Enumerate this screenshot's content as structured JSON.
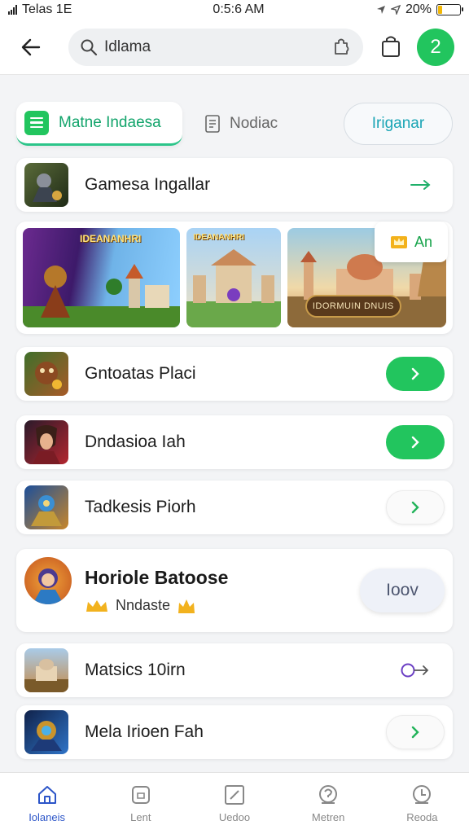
{
  "status_bar": {
    "carrier": "Telas 1E",
    "time": "0:5:6 AM",
    "battery_percent": "20%",
    "battery_level": 0.2
  },
  "header": {
    "search_value": "Idlama",
    "avatar_text": "2"
  },
  "tabs": {
    "active_label": "Matne Indaesa",
    "second_label": "Nodiac",
    "pill_label": "Iriganar"
  },
  "list": {
    "first_item": "Gamesa Ingallar",
    "banner_top_text": "IDEANANHRI",
    "banner_caption": "IDORMUIN DNUIS",
    "banner_badge_label": "An",
    "items": [
      {
        "title": "Gntoatas Placi",
        "action": "green"
      },
      {
        "title": "Dndasioa Iah",
        "action": "green"
      },
      {
        "title": "Tadkesis Piorh",
        "action": "white"
      }
    ],
    "featured": {
      "title": "Horiole Batoose",
      "subtitle": "Nndaste",
      "button_label": "Ioov"
    },
    "items_after": [
      {
        "title": "Matsics 10irn",
        "action": "circle"
      },
      {
        "title": "Mela Irioen Fah",
        "action": "white"
      }
    ]
  },
  "bottom_nav": [
    {
      "label": "Iolaneis",
      "icon": "home-icon",
      "active": true
    },
    {
      "label": "Lent",
      "icon": "shield-icon",
      "active": false
    },
    {
      "label": "Uedoo",
      "icon": "edit-icon",
      "active": false
    },
    {
      "label": "Metren",
      "icon": "question-icon",
      "active": false
    },
    {
      "label": "Reoda",
      "icon": "clock-icon",
      "active": false
    }
  ],
  "colors": {
    "accent_green": "#22c55e",
    "active_tab_text": "#12a46b",
    "nav_active": "#2c55c8"
  }
}
